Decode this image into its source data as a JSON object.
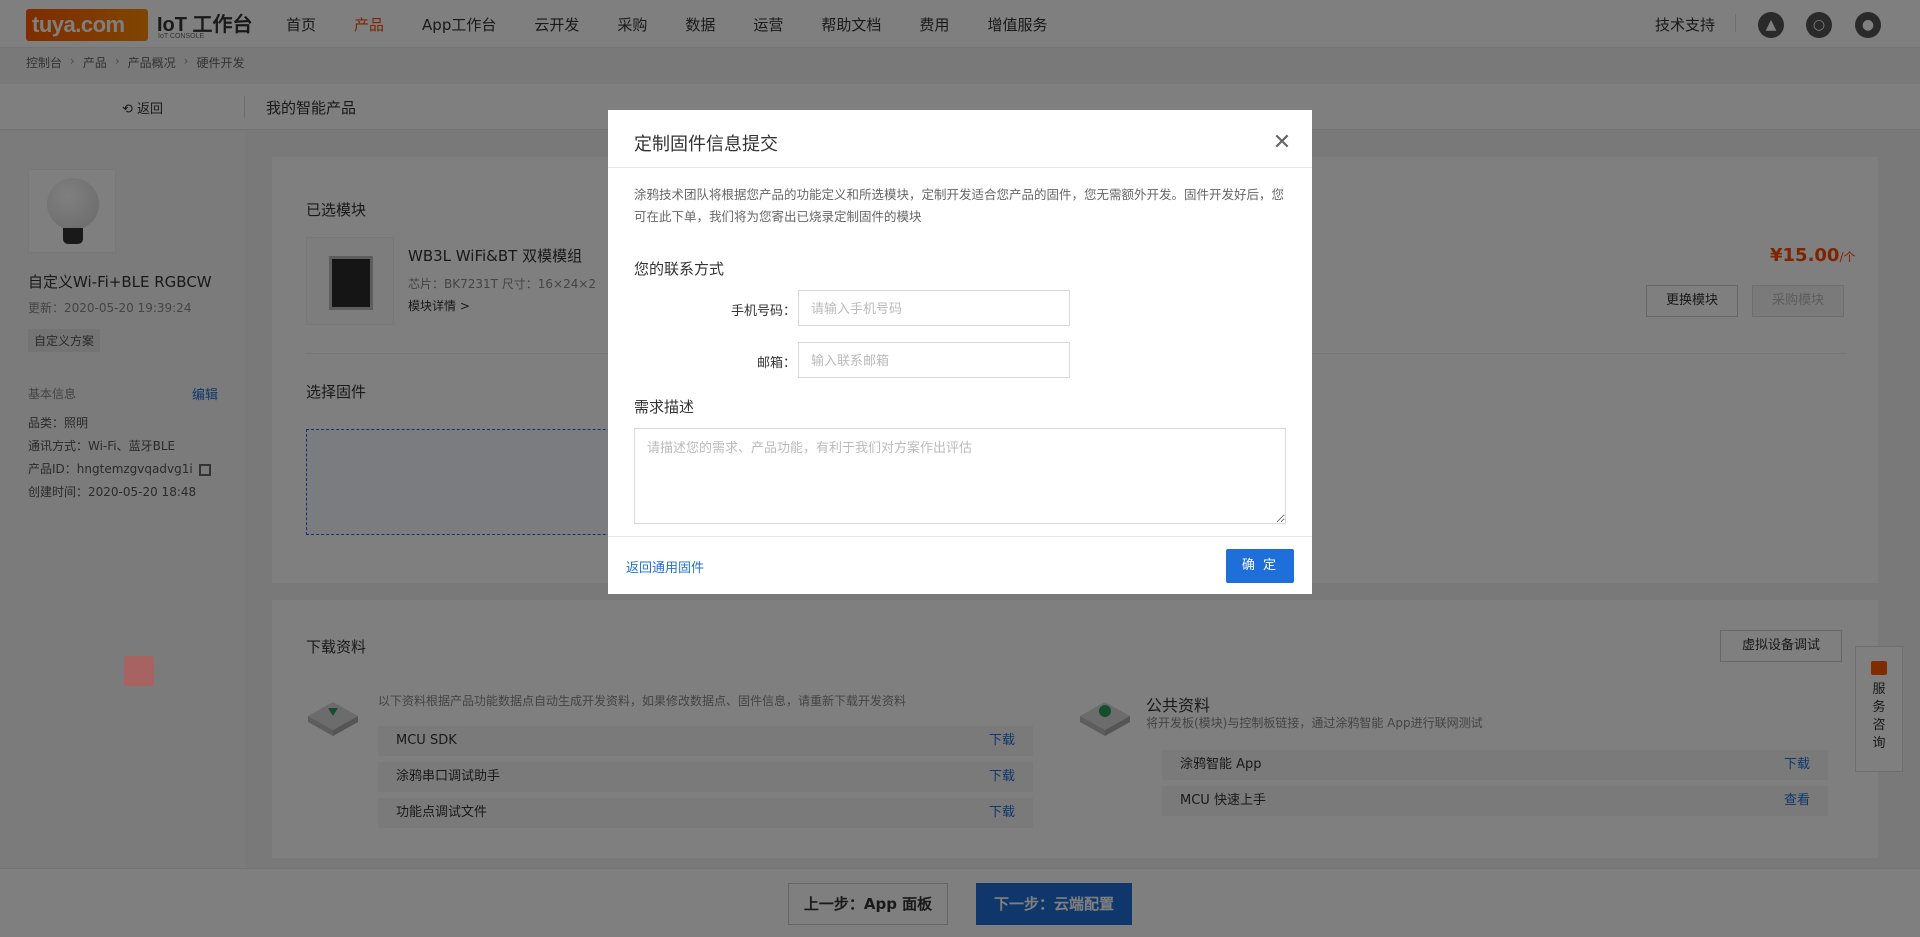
{
  "brand": {
    "logo_text": "tuya.com",
    "title": "IoT 工作台",
    "subtitle": "IoT CONSOLE"
  },
  "nav": {
    "items": [
      {
        "label": "首页"
      },
      {
        "label": "产品",
        "active": true
      },
      {
        "label": "App工作台"
      },
      {
        "label": "云开发"
      },
      {
        "label": "采购"
      },
      {
        "label": "数据"
      },
      {
        "label": "运营"
      },
      {
        "label": "帮助文档"
      },
      {
        "label": "费用"
      },
      {
        "label": "增值服务"
      }
    ],
    "support": "技术支持",
    "icons": [
      "bell-icon",
      "globe-icon",
      "user-icon"
    ]
  },
  "breadcrumb": [
    "控制台",
    "产品",
    "产品概况",
    "硬件开发"
  ],
  "subheader": {
    "back_label": "返回",
    "title": "我的智能产品"
  },
  "product": {
    "name": "自定义Wi-Fi+BLE RGBCW",
    "updated": "更新：2020-05-20 19:39:24",
    "tag": "自定义方案",
    "basic_info_title": "基本信息",
    "edit_label": "编辑",
    "category": "品类：照明",
    "protocol": "通讯方式：Wi-Fi、蓝牙BLE",
    "product_id": "产品ID：hngtemzgvqadvg1i",
    "created": "创建时间：2020-05-20 18:48"
  },
  "module_section": {
    "title": "已选模块",
    "module_name": "WB3L WiFi&BT 双模模组",
    "spec": "芯片：BK7231T   尺寸：16×24×2",
    "detail_link": "模块详情 >",
    "price": "¥15.00",
    "price_unit": "/个",
    "change_button": "更换模块",
    "buy_button": "采购模块"
  },
  "firmware_section": {
    "title": "选择固件"
  },
  "download_section": {
    "title": "下载资料",
    "virtual_debug_button": "虚拟设备调试",
    "note": "以下资料根据产品功能数据点自动生成开发资料，如果修改数据点、固件信息，请重新下载开发资料",
    "rows": [
      {
        "label": "MCU SDK",
        "action": "下载"
      },
      {
        "label": "涂鸦串口调试助手",
        "action": "下载"
      },
      {
        "label": "功能点调试文件",
        "action": "下载"
      }
    ],
    "public_title": "公共资料",
    "public_note": "将开发板(模块)与控制板链接，通过涂鸦智能 App进行联网测试",
    "public_rows": [
      {
        "label": "涂鸦智能 App",
        "action": "下载"
      },
      {
        "label": "MCU 快速上手",
        "action": "查看"
      }
    ]
  },
  "service_tab": {
    "label": "服务咨询"
  },
  "bottom": {
    "prev_label": "上一步：App 面板",
    "next_label": "下一步：云端配置"
  },
  "modal": {
    "title": "定制固件信息提交",
    "description": "涂鸦技术团队将根据您产品的功能定义和所选模块，定制开发适合您产品的固件，您无需额外开发。固件开发好后，您可在此下单，我们将为您寄出已烧录定制固件的模块",
    "contact_title": "您的联系方式",
    "phone_label": "手机号码：",
    "phone_placeholder": "请输入手机号码",
    "email_label": "邮箱：",
    "email_placeholder": "输入联系邮箱",
    "requirement_title": "需求描述",
    "requirement_placeholder": "请描述您的需求、产品功能，有利于我们对方案作出评估",
    "back_link": "返回通用固件",
    "confirm_label": "确 定"
  }
}
